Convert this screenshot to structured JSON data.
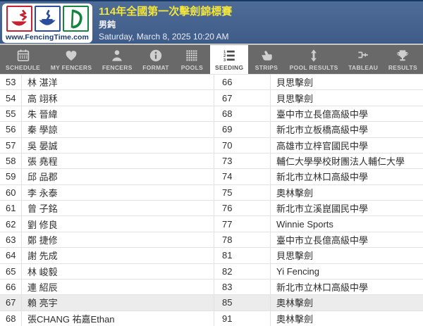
{
  "header": {
    "logo_text": "www.FencingTime.com",
    "logo_icons": [
      "foil-icon",
      "epee-icon",
      "sabre-icon"
    ],
    "title": "114年全國第一次擊劍錦標賽",
    "event": "男鈍",
    "datetime": "Saturday, March 8, 2025 10:20 AM"
  },
  "colors": {
    "header_blue": "#44608c",
    "accent_yellow": "#f3e53b",
    "toolbar_gray": "#696969",
    "logo_red": "#c32330",
    "logo_blue": "#2b4d9e",
    "logo_green": "#15843f",
    "row_highlight": "#ececec"
  },
  "toolbar": {
    "tabs": [
      {
        "label": "SCHEDULE",
        "icon": "calendar-icon",
        "active": false
      },
      {
        "label": "MY FENCERS",
        "icon": "heart-icon",
        "active": false
      },
      {
        "label": "FENCERS",
        "icon": "person-icon",
        "active": false
      },
      {
        "label": "FORMAT",
        "icon": "info-icon",
        "active": false
      },
      {
        "label": "POOLS",
        "icon": "grid-icon",
        "active": false
      },
      {
        "label": "SEEDING",
        "icon": "numbered-list-icon",
        "active": true
      },
      {
        "label": "STRIPS",
        "icon": "hand-icon",
        "active": false
      },
      {
        "label": "POOL RESULTS",
        "icon": "updown-arrow-icon",
        "active": false
      },
      {
        "label": "TABLEAU",
        "icon": "bracket-icon",
        "active": false
      },
      {
        "label": "RESULTS",
        "icon": "trophy-icon",
        "active": false
      }
    ]
  },
  "table": {
    "rows": [
      {
        "seed": "53",
        "name": "林 湛洋",
        "rank": "66",
        "club": "貝思擊劍",
        "highlight": false
      },
      {
        "seed": "54",
        "name": "高 翊秝",
        "rank": "67",
        "club": "貝思擊劍",
        "highlight": false
      },
      {
        "seed": "55",
        "name": "朱 晉緯",
        "rank": "68",
        "club": "臺中市立長億高級中學",
        "highlight": false
      },
      {
        "seed": "56",
        "name": "秦 學諒",
        "rank": "69",
        "club": "新北市立板橋高級中學",
        "highlight": false
      },
      {
        "seed": "57",
        "name": "吳 晏誠",
        "rank": "70",
        "club": "高雄市立梓官國民中學",
        "highlight": false
      },
      {
        "seed": "58",
        "name": "張 堯程",
        "rank": "73",
        "club": "輔仁大學學校財團法人輔仁大學",
        "highlight": false
      },
      {
        "seed": "59",
        "name": "邱 品郡",
        "rank": "74",
        "club": "新北市立林口高級中學",
        "highlight": false
      },
      {
        "seed": "60",
        "name": "李 永泰",
        "rank": "75",
        "club": "奧林擊劍",
        "highlight": false
      },
      {
        "seed": "61",
        "name": "曾 子銘",
        "rank": "76",
        "club": "新北市立溪崑國民中學",
        "highlight": false
      },
      {
        "seed": "62",
        "name": "劉 修良",
        "rank": "77",
        "club": "Winnie Sports",
        "highlight": false
      },
      {
        "seed": "63",
        "name": "鄭 捷修",
        "rank": "78",
        "club": "臺中市立長億高級中學",
        "highlight": false
      },
      {
        "seed": "64",
        "name": "謝 先成",
        "rank": "81",
        "club": "貝思擊劍",
        "highlight": false
      },
      {
        "seed": "65",
        "name": "林 峻毅",
        "rank": "82",
        "club": "Yi Fencing",
        "highlight": false
      },
      {
        "seed": "66",
        "name": "連 紹辰",
        "rank": "83",
        "club": "新北市立林口高級中學",
        "highlight": false
      },
      {
        "seed": "67",
        "name": "賴 亮宇",
        "rank": "85",
        "club": "奧林擊劍",
        "highlight": true
      },
      {
        "seed": "68",
        "name": "張CHANG 祐嘉Ethan",
        "rank": "91",
        "club": "奧林擊劍",
        "highlight": false
      }
    ]
  }
}
